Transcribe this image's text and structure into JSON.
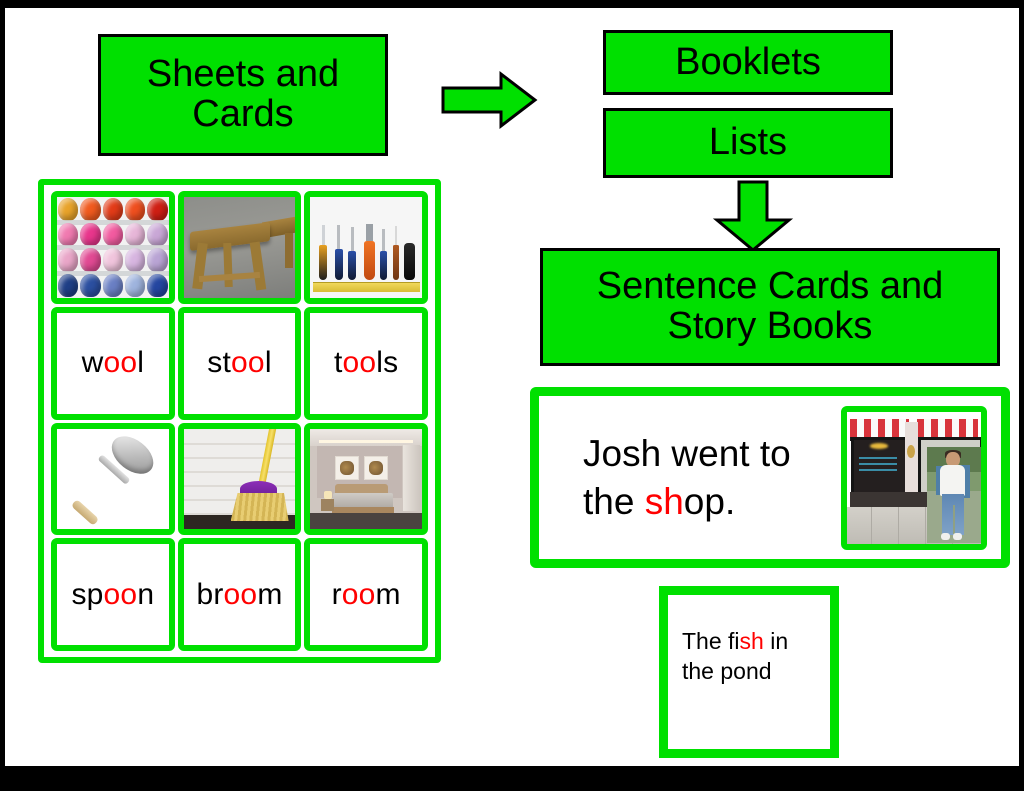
{
  "page": {
    "border_color": "#000000",
    "background": "#ffffff",
    "accent_green": "#00e000",
    "highlight_red": "#ff0000"
  },
  "flow": {
    "sheets_and_cards": "Sheets and\nCards",
    "sheets_and_cards_line1": "Sheets and",
    "sheets_and_cards_line2": "Cards",
    "booklets": "Booklets",
    "lists": "Lists",
    "sentence_cards_line1": "Sentence Cards and",
    "sentence_cards_line2": "Story Books",
    "arrow_right": "right-arrow",
    "arrow_down": "down-arrow"
  },
  "grid": {
    "columns": 3,
    "rows": 4,
    "picture_row_1": [
      {
        "name": "wool-picture",
        "alt": "balls of coloured wool on shelves"
      },
      {
        "name": "stool-picture",
        "alt": "wooden stool on stone floor"
      },
      {
        "name": "tools-picture",
        "alt": "screwdrivers, pliers and tape measure"
      }
    ],
    "word_row_1": [
      {
        "pre": "w",
        "hl": "oo",
        "post": "l",
        "word": "wool"
      },
      {
        "pre": "st",
        "hl": "oo",
        "post": "l",
        "word": "stool"
      },
      {
        "pre": "t",
        "hl": "oo",
        "post": "ls",
        "word": "tools"
      }
    ],
    "picture_row_2": [
      {
        "name": "spoon-picture",
        "alt": "metal spoon with wooden handle"
      },
      {
        "name": "broom-picture",
        "alt": "purple broom against white brick wall"
      },
      {
        "name": "room-picture",
        "alt": "modern bedroom interior"
      }
    ],
    "word_row_2": [
      {
        "pre": "sp",
        "hl": "oo",
        "post": "n",
        "word": "spoon"
      },
      {
        "pre": "br",
        "hl": "oo",
        "post": "m",
        "word": "broom"
      },
      {
        "pre": "r",
        "hl": "oo",
        "post": "m",
        "word": "room"
      }
    ]
  },
  "sentence_card": {
    "line1_pre": "Josh went to",
    "line2_pre": "the ",
    "line2_hl": "sh",
    "line2_post": "op.",
    "full_text": "Josh went to the shop.",
    "picture": {
      "name": "shop-picture",
      "alt": "shop front with red striped awnings and a man walking"
    }
  },
  "story_card": {
    "line1_pre": "The fi",
    "line1_hl": "sh",
    "line1_post": " in",
    "line2": "the pond",
    "full_text": "The fish in the pond"
  }
}
